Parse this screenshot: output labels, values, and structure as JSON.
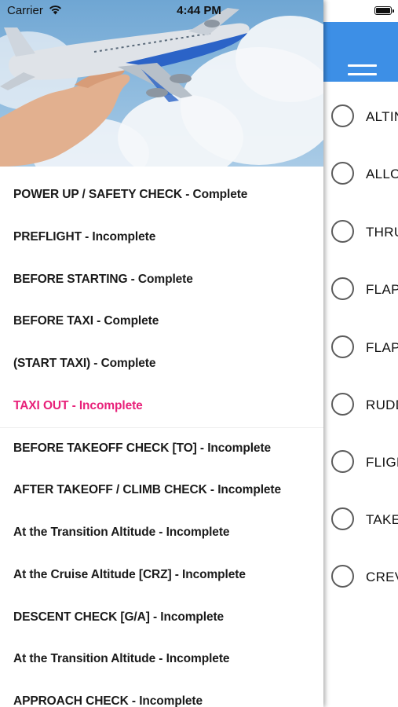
{
  "status_bar": {
    "carrier": "Carrier",
    "time": "4:44 PM"
  },
  "drawer": {
    "items": [
      {
        "label": "POWER UP / SAFETY CHECK - Complete"
      },
      {
        "label": "PREFLIGHT - Incomplete"
      },
      {
        "label": "BEFORE STARTING - Complete"
      },
      {
        "label": "BEFORE TAXI - Complete"
      },
      {
        "label": "(START TAXI) - Complete"
      },
      {
        "label": "TAXI OUT - Incomplete"
      },
      {
        "label": "BEFORE TAKEOFF CHECK [TO] - Incomplete"
      },
      {
        "label": "AFTER TAKEOFF / CLIMB CHECK - Incomplete"
      },
      {
        "label": "At the Transition Altitude - Incomplete"
      },
      {
        "label": "At the Cruise Altitude [CRZ] - Incomplete"
      },
      {
        "label": "DESCENT CHECK [G/A] - Incomplete"
      },
      {
        "label": "At the Transition Altitude - Incomplete"
      },
      {
        "label": "APPROACH CHECK - Incomplete"
      }
    ],
    "active_index": 5,
    "active_color": "#e8217a"
  },
  "main": {
    "navbar_color": "#3d8fe6",
    "checklist": [
      {
        "label": "ALTIN"
      },
      {
        "label": "ALLO"
      },
      {
        "label": "THRU"
      },
      {
        "label": "FLAP"
      },
      {
        "label": "FLAP"
      },
      {
        "label": "RUDD"
      },
      {
        "label": "FLIGH"
      },
      {
        "label": "TAKE"
      },
      {
        "label": "CREV"
      }
    ]
  },
  "icons": [
    "wifi-icon",
    "battery-icon",
    "hamburger-menu-icon",
    "airplane-hand-image"
  ]
}
